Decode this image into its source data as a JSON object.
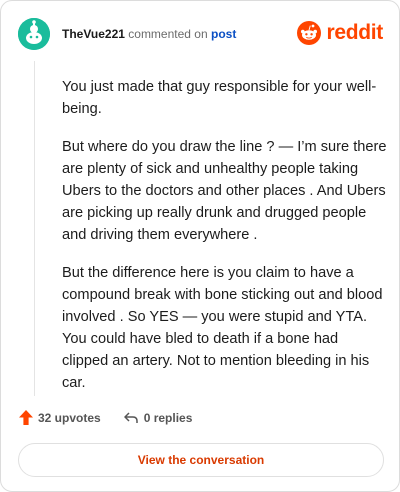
{
  "comment": {
    "author": "TheVue221",
    "action_text": "commented on",
    "target_text": "post",
    "paragraphs": [
      "You just made that guy responsible for your well-being.",
      "But where do you draw the line ? — I’m sure there are plenty of sick and unhealthy people taking Ubers to the doctors and other places . And Ubers are picking up really drunk and drugged people and driving them everywhere .",
      "But the difference here is you claim to have a compound break with bone sticking out and blood involved . So YES — you were stupid and YTA. You could have bled to death if a bone had clipped an artery. Not to mention bleeding in his car."
    ]
  },
  "brand": {
    "name": "reddit",
    "color": "#ff4500",
    "icon": "reddit-snoo-icon"
  },
  "actions": {
    "upvotes_label": "32 upvotes",
    "replies_label": "0 replies",
    "upvote_icon": "upvote-arrow-icon",
    "reply_icon": "reply-arrow-icon"
  },
  "cta": {
    "label": "View the conversation"
  },
  "colors": {
    "avatar": "#1abc9c",
    "upvote": "#ff4500",
    "link": "#0a4fc4",
    "cta_text": "#d93a00"
  }
}
